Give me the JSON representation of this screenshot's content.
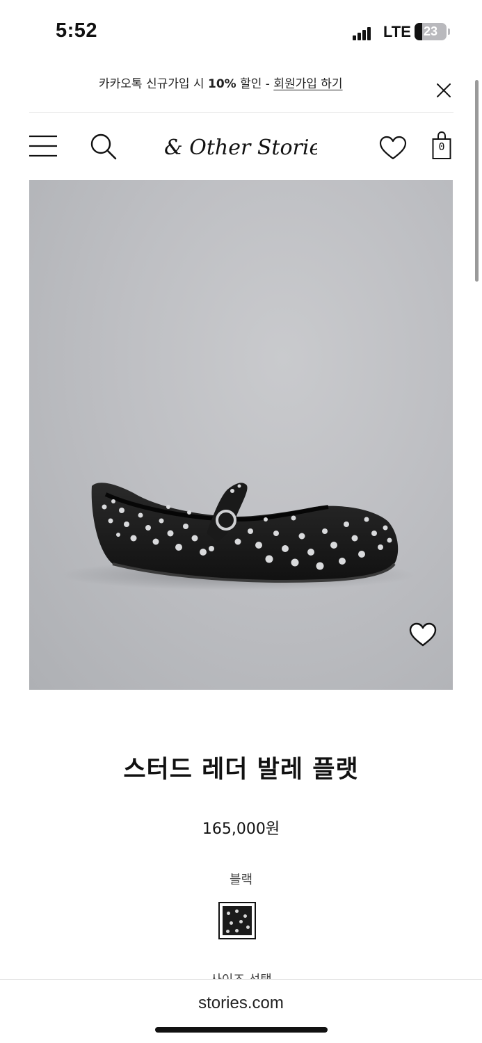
{
  "status_bar": {
    "time": "5:52",
    "network": "LTE",
    "battery": "23",
    "battery_level": 0.23
  },
  "promo": {
    "text_prefix": "카카오톡 신규가입 시 ",
    "discount": "10%",
    "text_middle": " 할인 - ",
    "link_label": "회원가입 하기",
    "close_icon": "close-icon"
  },
  "nav": {
    "menu_icon": "hamburger-menu-icon",
    "search_icon": "search-icon",
    "brand": "& Other Stories",
    "wishlist_icon": "heart-icon",
    "bag_icon": "shopping-bag-icon",
    "bag_count": "0"
  },
  "product": {
    "image_subject": "black studded leather ballet flat",
    "wishlist_icon": "heart-icon",
    "title": "스터드 레더 발레 플랫",
    "price": "165,000원",
    "color_name": "블랙",
    "size_label": "사이즈 선택"
  },
  "browser": {
    "url": "stories.com"
  }
}
